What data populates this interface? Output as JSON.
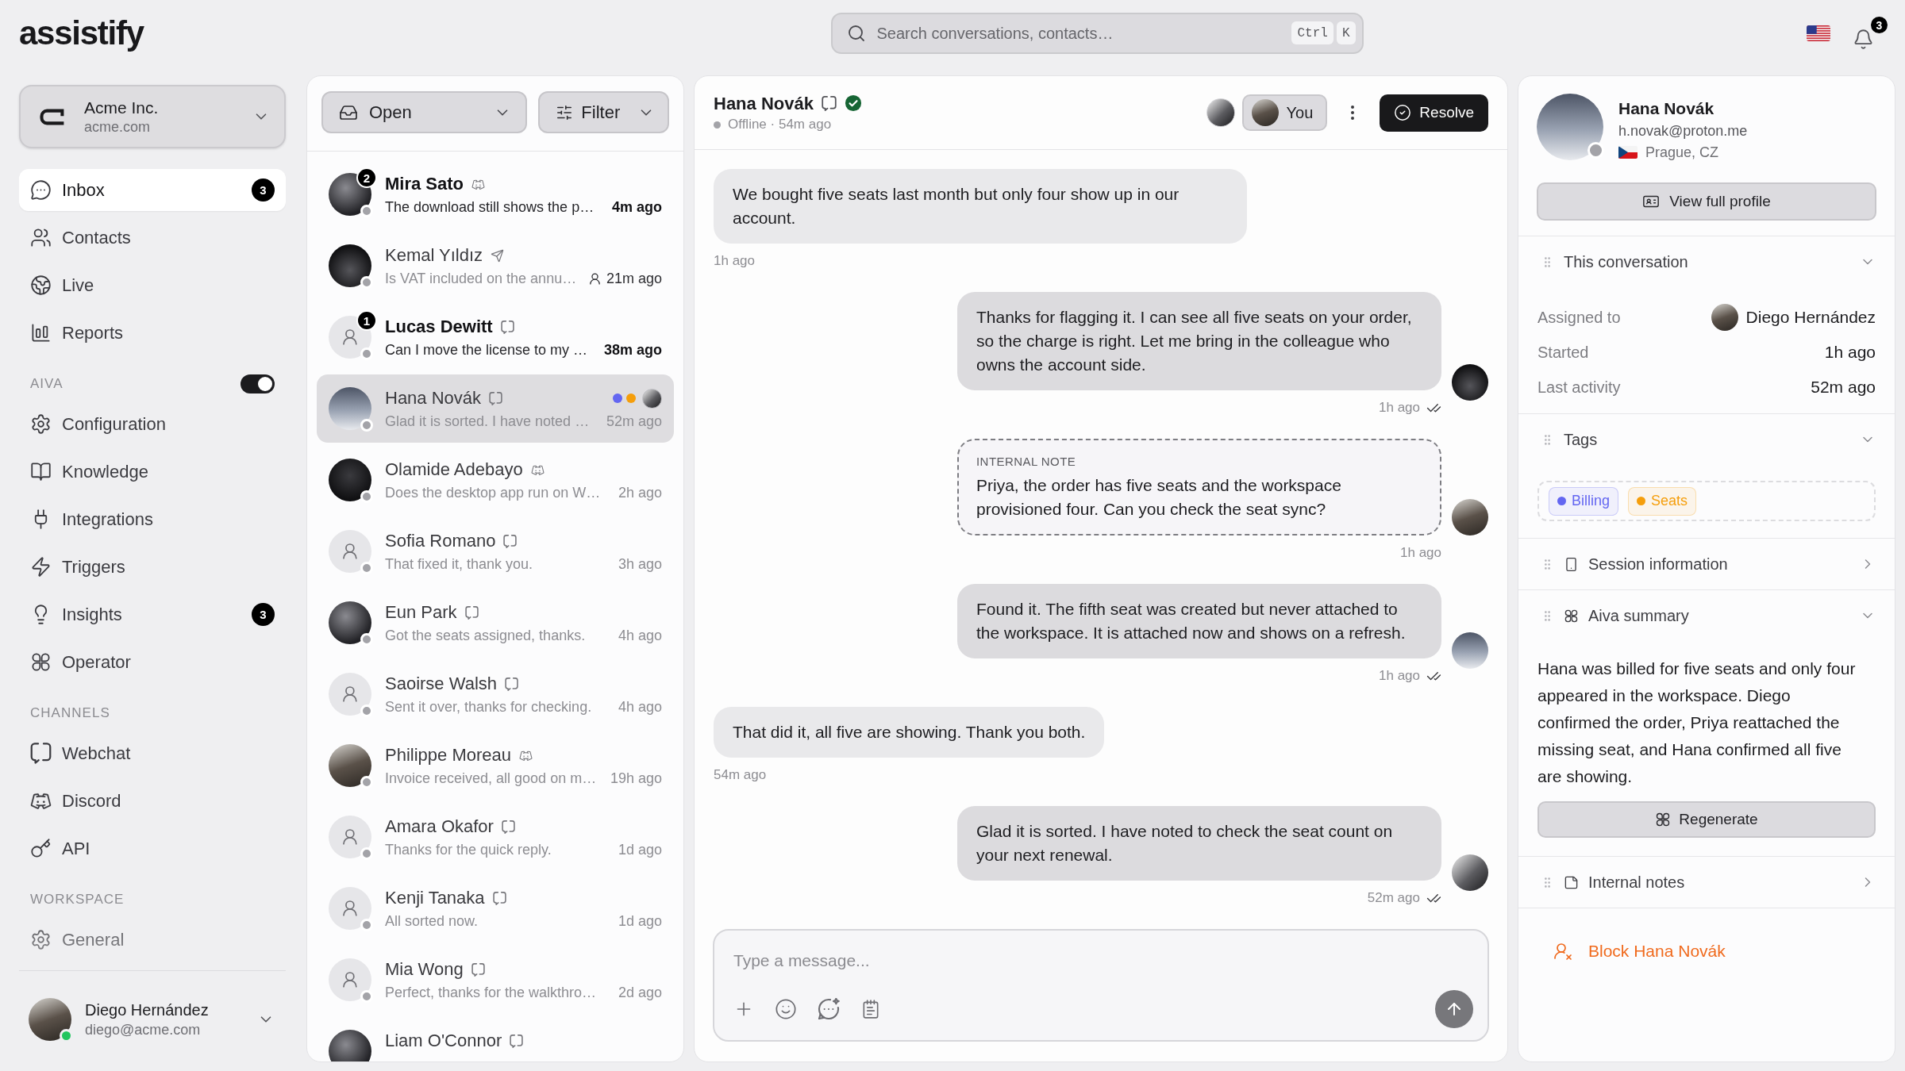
{
  "logo": {
    "text": "assistify"
  },
  "top_bar": {
    "search": {
      "placeholder": "Search conversations, contacts…",
      "keys": [
        "Ctrl",
        "K"
      ]
    },
    "notifications": {
      "badge": "3"
    }
  },
  "sidebar": {
    "workspace": {
      "name": "Acme Inc.",
      "domain": "acme.com"
    },
    "sections": [
      {
        "items": [
          {
            "label": "Inbox",
            "selected": true,
            "badge": "3"
          },
          {
            "label": "Contacts",
            "selected": false
          },
          {
            "label": "Live",
            "selected": false
          },
          {
            "label": "Reports",
            "selected": false
          }
        ]
      },
      {
        "title": "AIVA",
        "toggle": {
          "on": true
        },
        "items": [
          {
            "label": "Configuration",
            "selected": false
          },
          {
            "label": "Knowledge",
            "selected": false
          },
          {
            "label": "Integrations",
            "selected": false
          },
          {
            "label": "Triggers",
            "selected": false
          },
          {
            "label": "Insights",
            "selected": false,
            "badge": "3"
          },
          {
            "label": "Operator",
            "selected": false
          }
        ]
      },
      {
        "title": "CHANNELS",
        "items": [
          {
            "label": "Webchat",
            "selected": false
          },
          {
            "label": "Discord",
            "selected": false
          },
          {
            "label": "API",
            "selected": false
          }
        ]
      },
      {
        "title": "WORKSPACE",
        "items": [
          {
            "label": "General",
            "selected": false
          }
        ]
      }
    ],
    "user": {
      "name": "Diego Hernández",
      "email": "diego@acme.com",
      "online": true
    }
  },
  "conversations": {
    "status_filter": {
      "label": "Open"
    },
    "filter": {
      "label": "Filter"
    },
    "rows": [
      {
        "name": "Mira Sato",
        "kind": "discord",
        "preview": "The download still shows the p…",
        "time": "4m ago",
        "unread": true,
        "badge": "2",
        "highlighted": false,
        "photo": true,
        "assignee": false,
        "selected": false
      },
      {
        "name": "Kemal Yıldız",
        "kind": "telegram",
        "preview": "Is VAT included on the annu…",
        "time": "21m ago",
        "unread": false,
        "highlighted": true,
        "photo": true,
        "assignee": false,
        "selected": false
      },
      {
        "name": "Lucas Dewitt",
        "kind": "webchat",
        "preview": "Can I move the license to my …",
        "time": "38m ago",
        "unread": true,
        "badge": "1",
        "highlighted": false,
        "photo": false,
        "assignee": false,
        "selected": false
      },
      {
        "name": "Hana Novák",
        "kind": "webchat",
        "preview": "Glad it is sorted. I have noted …",
        "time": "52m ago",
        "unread": false,
        "highlighted": false,
        "photo": true,
        "assignee": true,
        "selected": true,
        "tag_dots": [
          {
            "color": "#6366f1"
          },
          {
            "color": "#f59e0b"
          }
        ]
      },
      {
        "name": "Olamide Adebayo",
        "kind": "discord",
        "preview": "Does the desktop app run on W…",
        "time": "2h ago",
        "unread": false,
        "highlighted": false,
        "photo": true,
        "assignee": false,
        "selected": false
      },
      {
        "name": "Sofia Romano",
        "kind": "webchat",
        "preview": "That fixed it, thank you.",
        "time": "3h ago",
        "unread": false,
        "highlighted": false,
        "photo": false,
        "assignee": false,
        "selected": false
      },
      {
        "name": "Eun Park",
        "kind": "webchat",
        "preview": "Got the seats assigned, thanks.",
        "time": "4h ago",
        "unread": false,
        "highlighted": false,
        "photo": true,
        "assignee": false,
        "selected": false
      },
      {
        "name": "Saoirse Walsh",
        "kind": "webchat",
        "preview": "Sent it over, thanks for checking.",
        "time": "4h ago",
        "unread": false,
        "highlighted": false,
        "photo": false,
        "assignee": false,
        "selected": false
      },
      {
        "name": "Philippe Moreau",
        "kind": "discord",
        "preview": "Invoice received, all good on m…",
        "time": "19h ago",
        "unread": false,
        "highlighted": false,
        "photo": true,
        "assignee": false,
        "selected": false
      },
      {
        "name": "Amara Okafor",
        "kind": "webchat",
        "preview": "Thanks for the quick reply.",
        "time": "1d ago",
        "unread": false,
        "highlighted": false,
        "photo": false,
        "assignee": false,
        "selected": false
      },
      {
        "name": "Kenji Tanaka",
        "kind": "webchat",
        "preview": "All sorted now.",
        "time": "1d ago",
        "unread": false,
        "highlighted": false,
        "photo": false,
        "assignee": false,
        "selected": false
      },
      {
        "name": "Mia Wong",
        "kind": "webchat",
        "preview": "Perfect, thanks for the walkthro…",
        "time": "2d ago",
        "unread": false,
        "highlighted": false,
        "photo": false,
        "assignee": false,
        "selected": false
      },
      {
        "name": "Liam O'Connor",
        "kind": "webchat",
        "unread": false,
        "highlighted": false,
        "photo": true,
        "assignee": false,
        "selected": false
      }
    ]
  },
  "chat": {
    "header": {
      "name": "Hana Novák",
      "kind": "webchat",
      "verified": true,
      "online": false,
      "status": "Offline · 54m ago",
      "you_button": {
        "label": "You"
      },
      "resolve_button": {
        "label": "Resolve"
      }
    },
    "messages": [
      {
        "kind": "inbound",
        "text": "We bought five seats last month but only four show up in our account.",
        "time": "1h ago"
      },
      {
        "kind": "outbound",
        "text": "Thanks for flagging it. I can see all five seats on your order, so the charge is right. Let me bring in the colleague who owns the account side.",
        "time": "1h ago",
        "read": true
      },
      {
        "kind": "note",
        "label": "INTERNAL NOTE",
        "text": "Priya, the order has five seats and the workspace provisioned four. Can you check the seat sync?",
        "time": "1h ago",
        "read": false
      },
      {
        "kind": "outbound",
        "text": "Found it. The fifth seat was created but never attached to the workspace. It is attached now and shows on a refresh.",
        "time": "1h ago",
        "read": true
      },
      {
        "kind": "inbound",
        "text": "That did it, all five are showing. Thank you both.",
        "time": "54m ago"
      },
      {
        "kind": "outbound",
        "text": "Glad it is sorted. I have noted to check the seat count on your next renewal.",
        "time": "52m ago",
        "read": true
      }
    ],
    "composer": {
      "placeholder": "Type a message..."
    }
  },
  "details": {
    "contact": {
      "name": "Hana Novák",
      "email": "h.novak@proton.me",
      "location": "Prague, CZ",
      "online": false,
      "profile_button": "View full profile"
    },
    "sections": [
      {
        "kind": "details",
        "title": "This conversation",
        "expanded": true,
        "rows": [
          {
            "label": "Assigned to",
            "value": "Diego Hernández",
            "avatar": true
          },
          {
            "label": "Started",
            "value": "1h ago",
            "avatar": false
          },
          {
            "label": "Last activity",
            "value": "52m ago",
            "avatar": false
          }
        ]
      },
      {
        "kind": "tags",
        "title": "Tags",
        "expanded": true,
        "tags": [
          {
            "label": "Billing",
            "color": "#6366f1"
          },
          {
            "label": "Seats",
            "color": "#f59e0b"
          }
        ]
      },
      {
        "kind": "session",
        "title": "Session information",
        "expanded": false
      },
      {
        "kind": "summary",
        "title": "Aiva summary",
        "expanded": true,
        "text": "Hana was billed for five seats and only four appeared in the workspace. Diego confirmed the order, Priya reattached the missing seat, and Hana confirmed all five are showing.",
        "button": "Regenerate"
      },
      {
        "kind": "notes",
        "title": "Internal notes",
        "expanded": false
      }
    ],
    "block": {
      "label": "Block Hana Novák"
    }
  }
}
